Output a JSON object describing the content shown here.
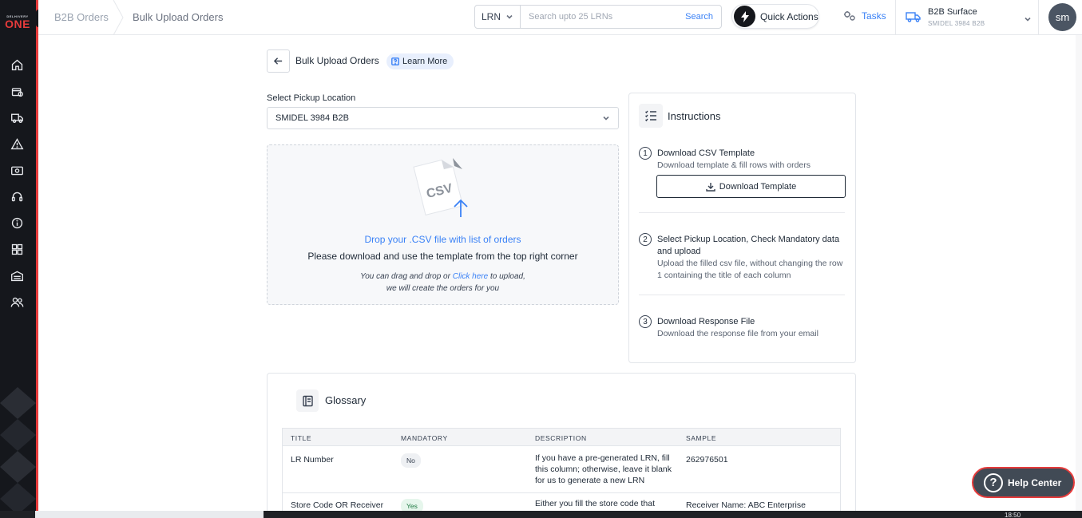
{
  "brand": {
    "small": "DELHIVERY",
    "big": "ONE"
  },
  "breadcrumb": {
    "parent": "B2B Orders",
    "current": "Bulk Upload Orders"
  },
  "search": {
    "type": "LRN",
    "placeholder": "Search upto 25 LRNs",
    "button": "Search"
  },
  "header": {
    "quick_actions": "Quick Actions",
    "tasks": "Tasks",
    "surface_name": "B2B Surface",
    "surface_sub": "SMIDEL 3984 B2B",
    "avatar": "sm"
  },
  "page": {
    "title": "Bulk Upload Orders",
    "learn_more": "Learn More"
  },
  "pickup": {
    "label": "Select Pickup Location",
    "value": "SMIDEL 3984 B2B"
  },
  "dropzone": {
    "art_text": "CSV",
    "title": "Drop your .CSV file with list of orders",
    "subtitle": "Please download and use the template from the top right corner",
    "hint_before": "You can drag and drop or ",
    "hint_link": "Click here",
    "hint_after": " to upload,",
    "hint_line2": "we will create the orders for you"
  },
  "instructions": {
    "title": "Instructions",
    "steps": [
      {
        "num": "1",
        "title": "Download CSV Template",
        "desc": "Download template & fill rows with orders",
        "button": "Download Template"
      },
      {
        "num": "2",
        "title": "Select Pickup Location, Check Mandatory data and upload",
        "desc": "Upload the filled csv file, without changing the row 1 containing the title of each column"
      },
      {
        "num": "3",
        "title": "Download Response File",
        "desc": "Download the response file from your email"
      }
    ]
  },
  "glossary": {
    "title": "Glossary",
    "columns": [
      "TITLE",
      "MANDATORY",
      "DESCRIPTION",
      "SAMPLE"
    ],
    "rows": [
      {
        "title": "LR Number",
        "mandatory": "No",
        "description": "If you have a pre-generated LRN, fill this column; otherwise, leave it blank for us to generate a new LRN",
        "sample": "262976501"
      },
      {
        "title": "Store Code OR Receiver",
        "mandatory": "Yes",
        "description": "Either you fill the store code that",
        "sample": "Receiver Name: ABC Enterprise"
      }
    ]
  },
  "help": {
    "label": "Help Center",
    "glyph": "?"
  },
  "taskbar": {
    "clock": "18:50"
  },
  "colors": {
    "accent": "#3b82f6",
    "brand_red": "#e63b3b",
    "sidebar_bg": "#15171c"
  }
}
